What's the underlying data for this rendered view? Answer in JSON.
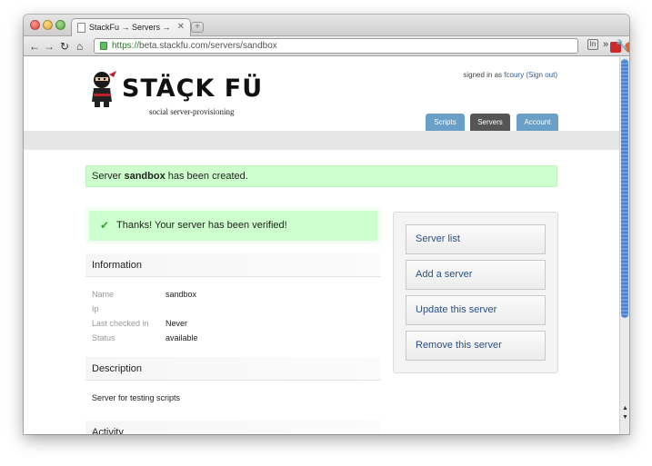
{
  "browser": {
    "tab_title": "StackFu → Servers → sandbox",
    "tab_close": "✕",
    "new_tab": "+",
    "url_protocol": "https://",
    "url_rest": "beta.stackfu.com/servers/sandbox",
    "toolbar_overflow": "»",
    "bookmark_btn": "In"
  },
  "header": {
    "brand": "STÄÇK FÜ",
    "tagline": "social server-provisioning",
    "signed_in_prefix": "signed in as",
    "username": "fcoury",
    "sign_out": "(Sign out)"
  },
  "nav": {
    "tabs": [
      {
        "label": "Scripts"
      },
      {
        "label": "Servers"
      },
      {
        "label": "Account"
      }
    ],
    "active_color": "#555555",
    "inactive_color": "#6aa0c8"
  },
  "flash": {
    "prefix": "Server",
    "server_name": "sandbox",
    "suffix": "has been created."
  },
  "verified": {
    "message": "Thanks! Your server has been verified!"
  },
  "information": {
    "heading": "Information",
    "rows": [
      {
        "label": "Name",
        "value": "sandbox"
      },
      {
        "label": "Ip",
        "value": ""
      },
      {
        "label": "Last checked in",
        "value": "Never"
      },
      {
        "label": "Status",
        "value": "available"
      }
    ]
  },
  "description": {
    "heading": "Description",
    "text": "Server for testing scripts"
  },
  "activity": {
    "heading": "Activity"
  },
  "sidebar": {
    "items": [
      {
        "label": "Server list"
      },
      {
        "label": "Add a server"
      },
      {
        "label": "Update this server"
      },
      {
        "label": "Remove this server"
      }
    ]
  },
  "colors": {
    "flash_bg": "#ccffcc",
    "link": "#2a5d9a"
  }
}
